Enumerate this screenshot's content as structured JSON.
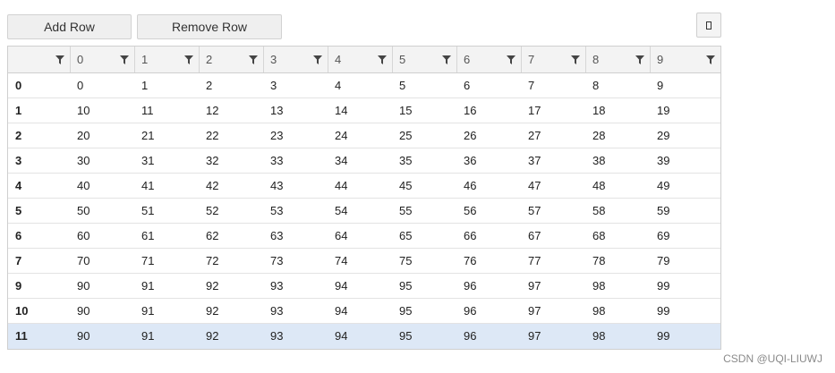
{
  "toolbar": {
    "add_label": "Add Row",
    "remove_label": "Remove Row"
  },
  "grid": {
    "columns": [
      "",
      "0",
      "1",
      "2",
      "3",
      "4",
      "5",
      "6",
      "7",
      "8",
      "9"
    ],
    "rows": [
      {
        "index": "0",
        "cells": [
          "0",
          "1",
          "2",
          "3",
          "4",
          "5",
          "6",
          "7",
          "8",
          "9"
        ]
      },
      {
        "index": "1",
        "cells": [
          "10",
          "11",
          "12",
          "13",
          "14",
          "15",
          "16",
          "17",
          "18",
          "19"
        ]
      },
      {
        "index": "2",
        "cells": [
          "20",
          "21",
          "22",
          "23",
          "24",
          "25",
          "26",
          "27",
          "28",
          "29"
        ]
      },
      {
        "index": "3",
        "cells": [
          "30",
          "31",
          "32",
          "33",
          "34",
          "35",
          "36",
          "37",
          "38",
          "39"
        ]
      },
      {
        "index": "4",
        "cells": [
          "40",
          "41",
          "42",
          "43",
          "44",
          "45",
          "46",
          "47",
          "48",
          "49"
        ]
      },
      {
        "index": "5",
        "cells": [
          "50",
          "51",
          "52",
          "53",
          "54",
          "55",
          "56",
          "57",
          "58",
          "59"
        ]
      },
      {
        "index": "6",
        "cells": [
          "60",
          "61",
          "62",
          "63",
          "64",
          "65",
          "66",
          "67",
          "68",
          "69"
        ]
      },
      {
        "index": "7",
        "cells": [
          "70",
          "71",
          "72",
          "73",
          "74",
          "75",
          "76",
          "77",
          "78",
          "79"
        ]
      },
      {
        "index": "9",
        "cells": [
          "90",
          "91",
          "92",
          "93",
          "94",
          "95",
          "96",
          "97",
          "98",
          "99"
        ]
      },
      {
        "index": "10",
        "cells": [
          "90",
          "91",
          "92",
          "93",
          "94",
          "95",
          "96",
          "97",
          "98",
          "99"
        ]
      },
      {
        "index": "11",
        "cells": [
          "90",
          "91",
          "92",
          "93",
          "94",
          "95",
          "96",
          "97",
          "98",
          "99"
        ]
      }
    ],
    "selected_row": 10,
    "selected_color": "#dde8f6",
    "filter_icon": "filter-icon"
  },
  "watermark": "CSDN @UQI-LIUWJ"
}
